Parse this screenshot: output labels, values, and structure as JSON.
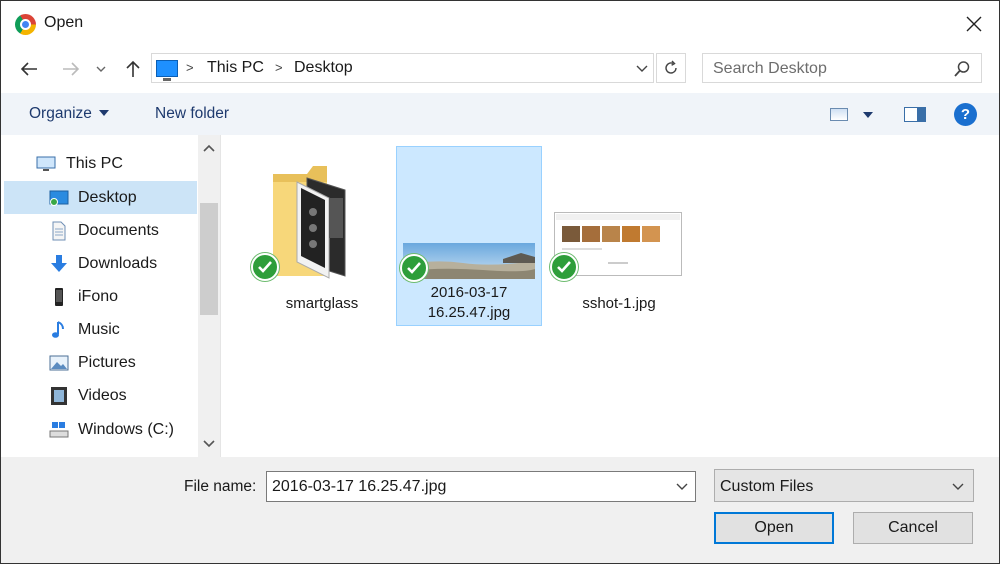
{
  "window": {
    "title": "Open"
  },
  "nav": {
    "breadcrumbs": [
      "This PC",
      "Desktop"
    ],
    "search_placeholder": "Search Desktop"
  },
  "toolbar": {
    "organize": "Organize",
    "new_folder": "New folder",
    "help": "?"
  },
  "tree": {
    "items": [
      {
        "label": "This PC",
        "icon": "monitor-icon"
      },
      {
        "label": "Desktop",
        "icon": "desktop-icon",
        "selected": true
      },
      {
        "label": "Documents",
        "icon": "document-icon"
      },
      {
        "label": "Downloads",
        "icon": "download-arrow-icon"
      },
      {
        "label": "iFono",
        "icon": "phone-icon"
      },
      {
        "label": "Music",
        "icon": "music-note-icon"
      },
      {
        "label": "Pictures",
        "icon": "pictures-icon"
      },
      {
        "label": "Videos",
        "icon": "film-icon"
      },
      {
        "label": "Windows (C:)",
        "icon": "drive-icon"
      }
    ]
  },
  "files": [
    {
      "name": "smartglass",
      "type": "folder",
      "synced": true
    },
    {
      "name_line1": "2016-03-17",
      "name_line2": "16.25.47.jpg",
      "type": "image",
      "selected": true,
      "synced": true
    },
    {
      "name": "sshot-1.jpg",
      "type": "image",
      "synced": true
    }
  ],
  "footer": {
    "file_name_label": "File name:",
    "file_name_value": "2016-03-17 16.25.47.jpg",
    "file_type": "Custom Files",
    "open_label": "Open",
    "cancel_label": "Cancel"
  },
  "colors": {
    "selection": "#cce8ff",
    "accent": "#0078d7",
    "sync_check": "#2e9e3a"
  }
}
